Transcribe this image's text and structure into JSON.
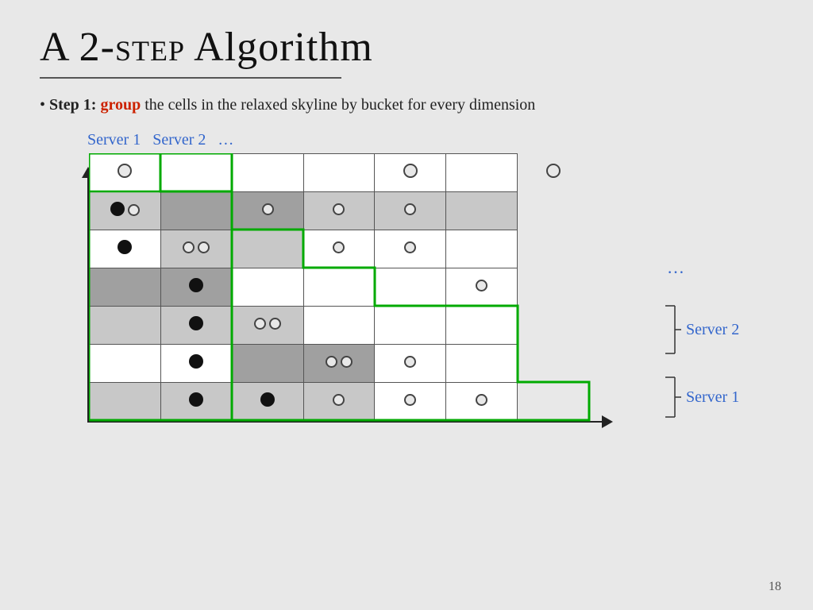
{
  "title": {
    "prefix": "A 2-",
    "step_word": "step",
    "suffix": " Algorithm"
  },
  "bullet": {
    "step_label": "Step 1:",
    "group_word": "group",
    "rest_text": " the cells in the relaxed skyline by bucket for every dimension"
  },
  "servers_top": {
    "server1": "Server 1",
    "server2": "Server 2",
    "dots": "…"
  },
  "right_labels": {
    "dots": "…",
    "server2": "Server 2",
    "server1": "Server 1"
  },
  "page_number": "18"
}
